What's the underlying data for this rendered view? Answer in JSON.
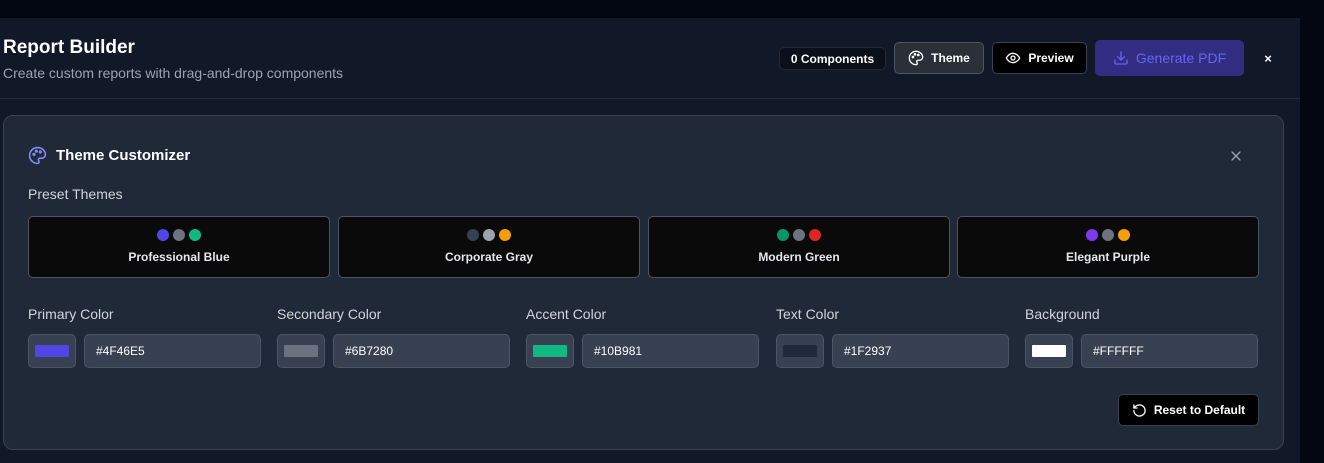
{
  "header": {
    "title": "Report Builder",
    "subtitle": "Create custom reports with drag-and-drop components",
    "components_count": "0 Components",
    "theme_label": "Theme",
    "preview_label": "Preview",
    "generate_label": "Generate PDF",
    "close_glyph": "×"
  },
  "theme_customizer": {
    "title": "Theme Customizer",
    "presets_label": "Preset Themes",
    "presets": [
      {
        "name": "Professional Blue",
        "colors": [
          "#4F46E5",
          "#6B7280",
          "#10B981"
        ]
      },
      {
        "name": "Corporate Gray",
        "colors": [
          "#374151",
          "#9CA3AF",
          "#F59E0B"
        ]
      },
      {
        "name": "Modern Green",
        "colors": [
          "#059669",
          "#6B7280",
          "#DC2626"
        ]
      },
      {
        "name": "Elegant Purple",
        "colors": [
          "#7C3AED",
          "#6B7280",
          "#F59E0B"
        ]
      }
    ],
    "colors": [
      {
        "label": "Primary Color",
        "value": "#4F46E5"
      },
      {
        "label": "Secondary Color",
        "value": "#6B7280"
      },
      {
        "label": "Accent Color",
        "value": "#10B981"
      },
      {
        "label": "Text Color",
        "value": "#1F2937"
      },
      {
        "label": "Background",
        "value": "#FFFFFF"
      }
    ],
    "reset_label": "Reset to Default"
  },
  "icons": {
    "palette": "palette-icon",
    "eye": "eye-icon",
    "download": "download-icon",
    "close": "close-icon",
    "reset": "rotate-ccw-icon"
  }
}
